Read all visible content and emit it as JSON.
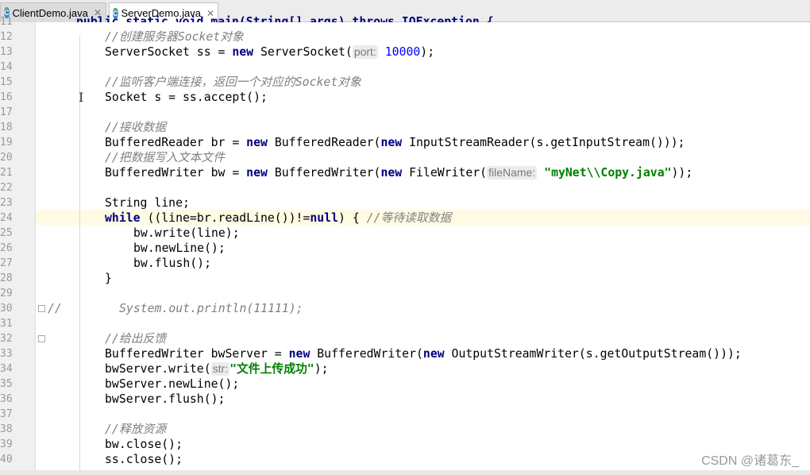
{
  "tabs": [
    {
      "label": "ClientDemo.java",
      "icon": "java-class-icon",
      "active": false
    },
    {
      "label": "ServerDemo.java",
      "icon": "java-class-icon",
      "active": true
    }
  ],
  "gutter": {
    "line_numbers": [
      "11",
      "12",
      "13",
      "14",
      "15",
      "16",
      "17",
      "18",
      "19",
      "20",
      "21",
      "22",
      "23",
      "24",
      "25",
      "26",
      "27",
      "28",
      "29",
      "30",
      "31",
      "32",
      "33",
      "34",
      "35",
      "36",
      "37",
      "38",
      "39",
      "40"
    ],
    "current_line": "24"
  },
  "code": {
    "l11": [
      "public static void main(String[] args) throws IOException {"
    ],
    "l12": [
      "//创建服务器Socket对象"
    ],
    "l13": [
      "ServerSocket ss = ",
      "new",
      " ServerSocket(",
      "port:",
      "10000",
      ");"
    ],
    "l15": [
      "//监听客户端连接，返回一个对应的Socket对象"
    ],
    "l16": [
      "Socket s = ss.accept();"
    ],
    "l18": [
      "//接收数据"
    ],
    "l19": [
      "BufferedReader br = ",
      "new",
      " BufferedReader(",
      "new",
      " InputStreamReader(s.getInputStream()));"
    ],
    "l20": [
      "//把数据写入文本文件"
    ],
    "l21": [
      "BufferedWriter bw = ",
      "new",
      " BufferedWriter(",
      "new",
      " FileWriter(",
      "fileName:",
      "\"myNet\\\\Copy.java\"",
      "));"
    ],
    "l23": [
      "String line;"
    ],
    "l24": [
      "while",
      " ((line=br.readLine())!=",
      "null",
      ") { ",
      "//等待读取数据"
    ],
    "l25": [
      "bw.write(line);"
    ],
    "l26": [
      "bw.newLine();"
    ],
    "l27": [
      "bw.flush();"
    ],
    "l28": [
      "}"
    ],
    "l30": [
      "//",
      "System.out.println(11111);"
    ],
    "l32": [
      "//给出反馈"
    ],
    "l33": [
      "BufferedWriter bwServer = ",
      "new",
      " BufferedWriter(",
      "new",
      " OutputStreamWriter(s.getOutputStream()));"
    ],
    "l34": [
      "bwServer.write(",
      "str:",
      "\"文件上传成功\"",
      ");"
    ],
    "l35": [
      "bwServer.newLine();"
    ],
    "l36": [
      "bwServer.flush();"
    ],
    "l38": [
      "//释放资源"
    ],
    "l39": [
      "bw.close();"
    ],
    "l40": [
      "ss.close();"
    ]
  },
  "watermark": "CSDN @诸葛东_",
  "colors": {
    "keyword": "#000080",
    "number": "#0000ff",
    "string": "#008000",
    "comment": "#808080",
    "current_line_bg": "#fffae3",
    "tab_icon": "#3d88c8"
  }
}
